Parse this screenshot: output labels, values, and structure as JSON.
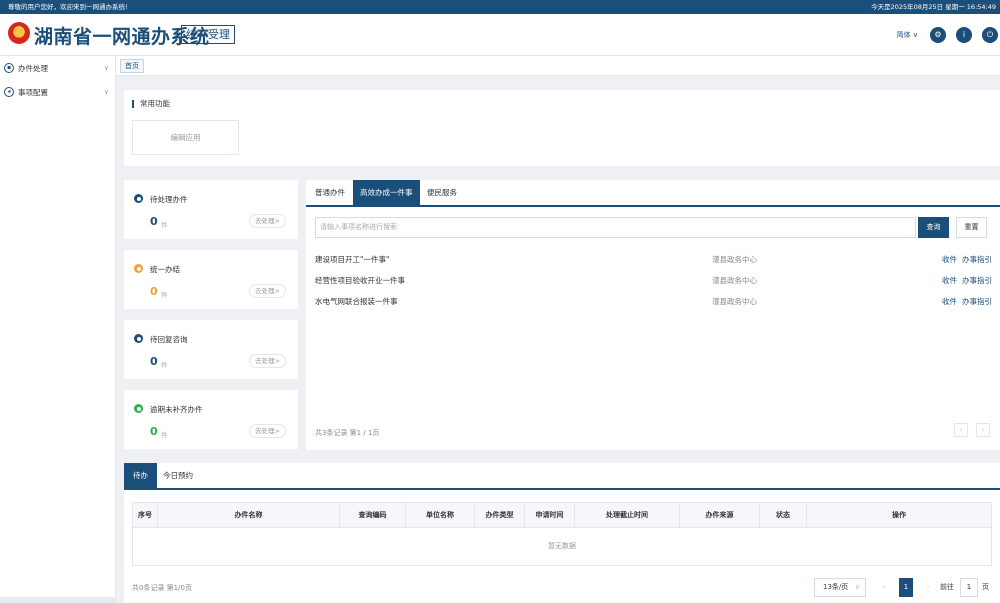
{
  "topbar": {
    "greeting": "尊敬的用户您好，欢迎来到一网通办系统!",
    "date": "今天是2025年08月25日 星期一 16:54:49"
  },
  "header": {
    "title": "湖南省一网通办系统",
    "sub_badge": "统一受理",
    "lang": "简体 ∨",
    "icons": [
      "settings-icon",
      "info-icon",
      "power-icon"
    ]
  },
  "sidebar": {
    "items": [
      {
        "label": "办件处理",
        "icon": "folder-icon"
      },
      {
        "label": "事项配置",
        "icon": "config-icon"
      }
    ]
  },
  "tabs_bar": {
    "home": "首页"
  },
  "common_functions": {
    "title": "常用功能",
    "edit_app": "编辑应用"
  },
  "stats": [
    {
      "label": "待处理办件",
      "value": "0",
      "unit": "件",
      "action": "去处理>",
      "color": "#1c4e7a"
    },
    {
      "label": "统一办结",
      "value": "0",
      "unit": "件",
      "action": "去处理>",
      "color": "#f0a030"
    },
    {
      "label": "待回复咨询",
      "value": "0",
      "unit": "件",
      "action": "去处理>",
      "color": "#1c4e7a"
    },
    {
      "label": "逾期未补齐办件",
      "value": "0",
      "unit": "件",
      "action": "去处理>",
      "color": "#2bb24c"
    }
  ],
  "panel": {
    "tabs": [
      "普通办件",
      "高效办成一件事",
      "便民服务"
    ],
    "active_tab": 1,
    "search_placeholder": "请输入事项名称进行搜索",
    "query": "查询",
    "reset": "重置",
    "rows": [
      {
        "name": "建设项目开工\"一件事\"",
        "org": "澧县政务中心",
        "act1": "收件",
        "act2": "办事指引"
      },
      {
        "name": "经营性项目验收开业一件事",
        "org": "澧县政务中心",
        "act1": "收件",
        "act2": "办事指引"
      },
      {
        "name": "水电气网联合报装一件事",
        "org": "澧县政务中心",
        "act1": "收件",
        "act2": "办事指引"
      }
    ],
    "footer": "共3条记录 第1 / 1页"
  },
  "todo": {
    "tabs": [
      "待办",
      "今日预约"
    ],
    "columns": [
      "序号",
      "办件名称",
      "查询编码",
      "单位名称",
      "办件类型",
      "申请时间",
      "处理截止时间",
      "办件来源",
      "状态",
      "操作"
    ],
    "empty": "暂无数据",
    "footer": "共0条记录 第1/0页",
    "page_size": "13条/页",
    "current_page": "1",
    "goto_label": "前往",
    "goto_value": "1",
    "page_unit": "页"
  }
}
